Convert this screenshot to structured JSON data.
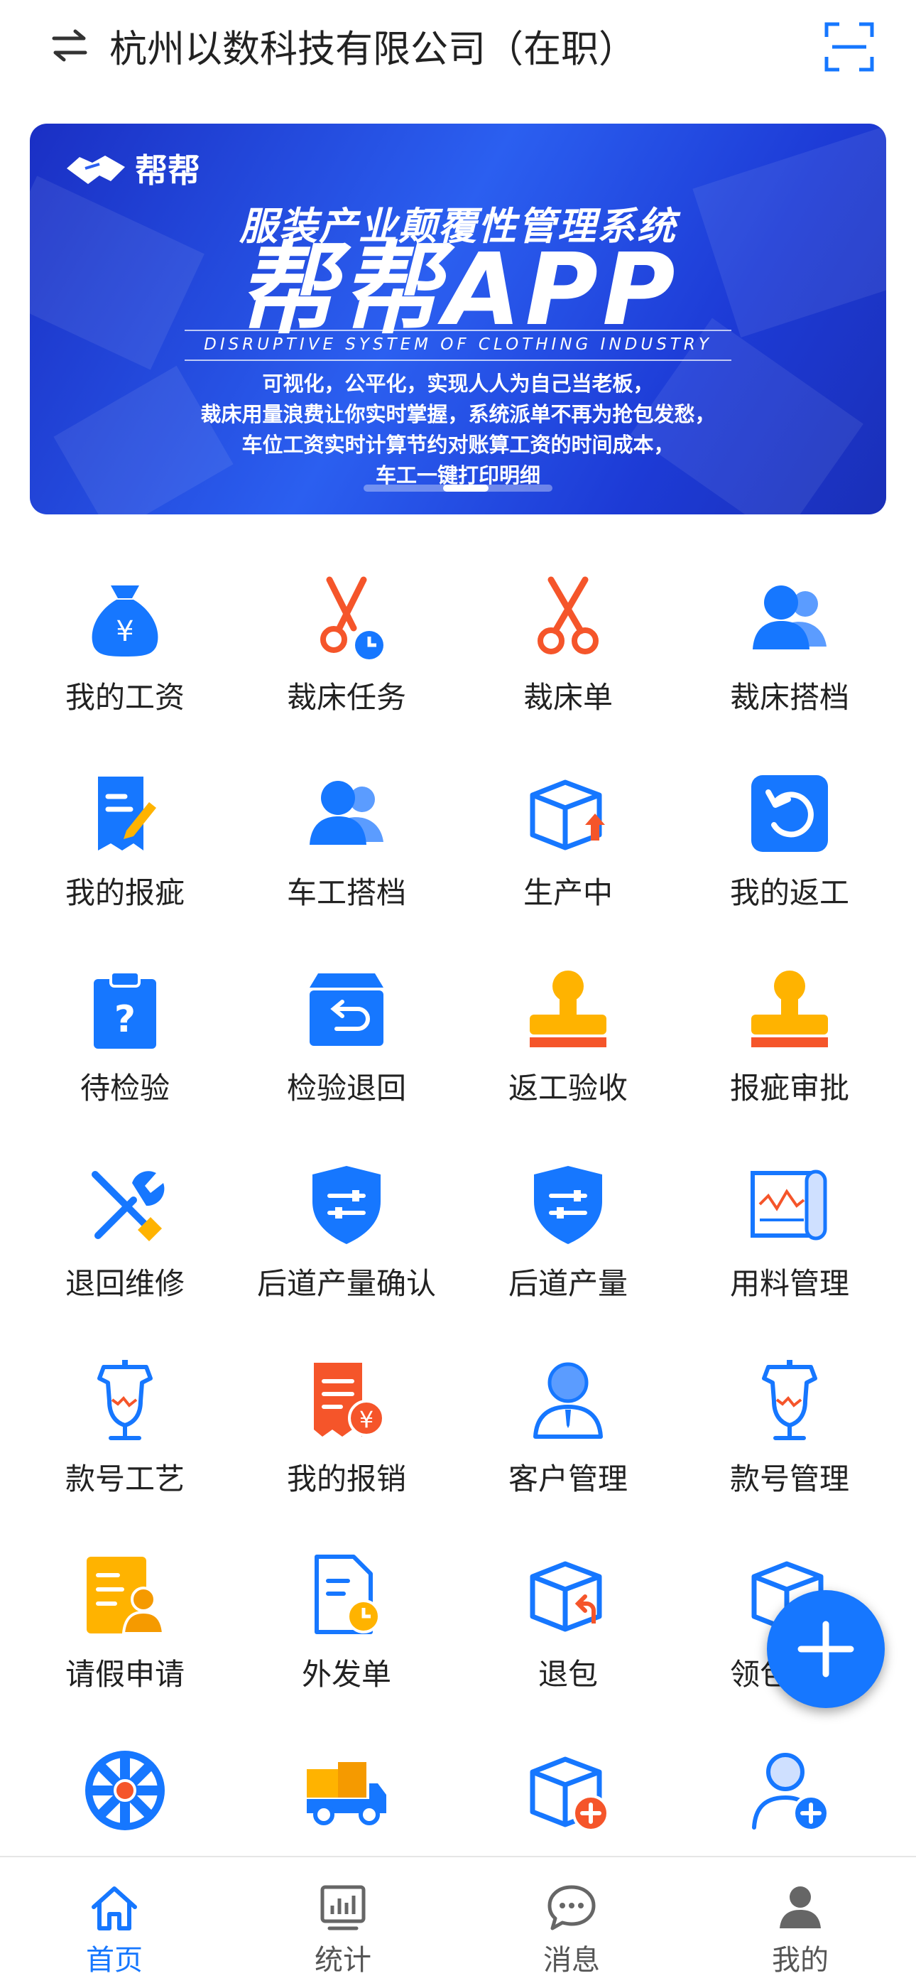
{
  "header": {
    "company": "杭州以数科技有限公司（在职）",
    "switch_icon": "switch-arrows-icon",
    "scan_icon": "scan-icon"
  },
  "banner": {
    "brand": "帮帮",
    "title": "服装产业颠覆性管理系统",
    "big_title": "帮帮APP",
    "subtitle": "DISRUPTIVE SYSTEM OF CLOTHING INDUSTRY",
    "lines": [
      "可视化，公平化，实现人人为自己当老板，",
      "裁床用量浪费让你实时掌握，系统派单不再为抢包发愁，",
      "车位工资实时计算节约对账算工资的时间成本，",
      "车工一键打印明细"
    ],
    "colors": {
      "primary": "#1a2fc4",
      "accent": "#2b5ff0"
    }
  },
  "menu": {
    "items": [
      {
        "label": "我的工资",
        "icon": "money-bag-icon"
      },
      {
        "label": "裁床任务",
        "icon": "scissors-clock-icon"
      },
      {
        "label": "裁床单",
        "icon": "scissors-icon"
      },
      {
        "label": "裁床搭档",
        "icon": "partners-icon"
      },
      {
        "label": "我的报疵",
        "icon": "report-edit-icon"
      },
      {
        "label": "车工搭档",
        "icon": "partners-icon"
      },
      {
        "label": "生产中",
        "icon": "box-upload-icon"
      },
      {
        "label": "我的返工",
        "icon": "redo-icon"
      },
      {
        "label": "待检验",
        "icon": "clipboard-question-icon"
      },
      {
        "label": "检验退回",
        "icon": "inbox-return-icon"
      },
      {
        "label": "返工验收",
        "icon": "stamp-icon"
      },
      {
        "label": "报疵审批",
        "icon": "stamp-icon"
      },
      {
        "label": "退回维修",
        "icon": "repair-tools-icon"
      },
      {
        "label": "后道产量确认",
        "icon": "shield-settings-icon"
      },
      {
        "label": "后道产量",
        "icon": "shield-settings-icon"
      },
      {
        "label": "用料管理",
        "icon": "fabric-roll-icon"
      },
      {
        "label": "款号工艺",
        "icon": "dress-form-icon"
      },
      {
        "label": "我的报销",
        "icon": "receipt-yen-icon"
      },
      {
        "label": "客户管理",
        "icon": "customer-icon"
      },
      {
        "label": "款号管理",
        "icon": "dress-form-icon"
      },
      {
        "label": "请假申请",
        "icon": "leave-request-icon"
      },
      {
        "label": "外发单",
        "icon": "document-clock-icon"
      },
      {
        "label": "退包",
        "icon": "box-return-icon"
      },
      {
        "label": "领包申请",
        "icon": "box-icon"
      },
      {
        "label": "",
        "icon": "wheel-icon"
      },
      {
        "label": "",
        "icon": "truck-icon"
      },
      {
        "label": "",
        "icon": "box-add-icon"
      },
      {
        "label": "",
        "icon": "user-add-icon"
      }
    ]
  },
  "fab": {
    "icon": "plus-icon"
  },
  "tabbar": {
    "tabs": [
      {
        "label": "首页",
        "icon": "home-icon",
        "active": true
      },
      {
        "label": "统计",
        "icon": "statistics-icon",
        "active": false
      },
      {
        "label": "消息",
        "icon": "message-icon",
        "active": false
      },
      {
        "label": "我的",
        "icon": "profile-icon",
        "active": false
      }
    ],
    "colors": {
      "active": "#1677ff",
      "inactive": "#555555"
    }
  }
}
